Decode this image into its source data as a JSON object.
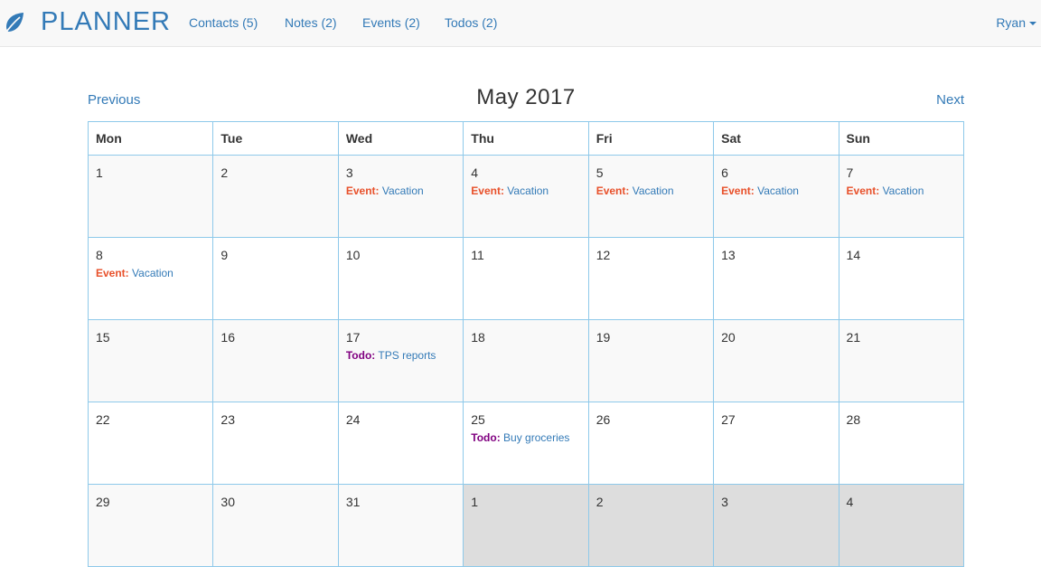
{
  "brand": {
    "name": "PLANNER",
    "icon": "leaf-icon"
  },
  "nav": {
    "contacts": "Contacts (5)",
    "notes": "Notes (2)",
    "events": "Events (2)",
    "todos": "Todos (2)",
    "user": "Ryan"
  },
  "calendar": {
    "title": "May 2017",
    "previous": "Previous",
    "next": "Next",
    "days": [
      "Mon",
      "Tue",
      "Wed",
      "Thu",
      "Fri",
      "Sat",
      "Sun"
    ],
    "weeks": [
      [
        {
          "day": "1"
        },
        {
          "day": "2"
        },
        {
          "day": "3",
          "entries": [
            {
              "type": "Event:",
              "kind": "event",
              "title": "Vacation"
            }
          ]
        },
        {
          "day": "4",
          "entries": [
            {
              "type": "Event:",
              "kind": "event",
              "title": "Vacation"
            }
          ]
        },
        {
          "day": "5",
          "entries": [
            {
              "type": "Event:",
              "kind": "event",
              "title": "Vacation"
            }
          ]
        },
        {
          "day": "6",
          "entries": [
            {
              "type": "Event:",
              "kind": "event",
              "title": "Vacation"
            }
          ]
        },
        {
          "day": "7",
          "entries": [
            {
              "type": "Event:",
              "kind": "event",
              "title": "Vacation"
            }
          ]
        }
      ],
      [
        {
          "day": "8",
          "entries": [
            {
              "type": "Event:",
              "kind": "event",
              "title": "Vacation"
            }
          ]
        },
        {
          "day": "9"
        },
        {
          "day": "10"
        },
        {
          "day": "11"
        },
        {
          "day": "12"
        },
        {
          "day": "13"
        },
        {
          "day": "14"
        }
      ],
      [
        {
          "day": "15"
        },
        {
          "day": "16"
        },
        {
          "day": "17",
          "entries": [
            {
              "type": "Todo:",
              "kind": "todo",
              "title": "TPS reports"
            }
          ]
        },
        {
          "day": "18"
        },
        {
          "day": "19"
        },
        {
          "day": "20"
        },
        {
          "day": "21"
        }
      ],
      [
        {
          "day": "22"
        },
        {
          "day": "23"
        },
        {
          "day": "24"
        },
        {
          "day": "25",
          "entries": [
            {
              "type": "Todo:",
              "kind": "todo",
              "title": "Buy groceries"
            }
          ]
        },
        {
          "day": "26"
        },
        {
          "day": "27"
        },
        {
          "day": "28"
        }
      ],
      [
        {
          "day": "29"
        },
        {
          "day": "30"
        },
        {
          "day": "31"
        },
        {
          "day": "1",
          "other": true
        },
        {
          "day": "2",
          "other": true
        },
        {
          "day": "3",
          "other": true
        },
        {
          "day": "4",
          "other": true
        }
      ]
    ]
  },
  "colors": {
    "link": "#337ab7",
    "event": "#e8512b",
    "todo": "#800080",
    "grid_border": "#8ec9ea",
    "other_month_bg": "#dddddd"
  }
}
